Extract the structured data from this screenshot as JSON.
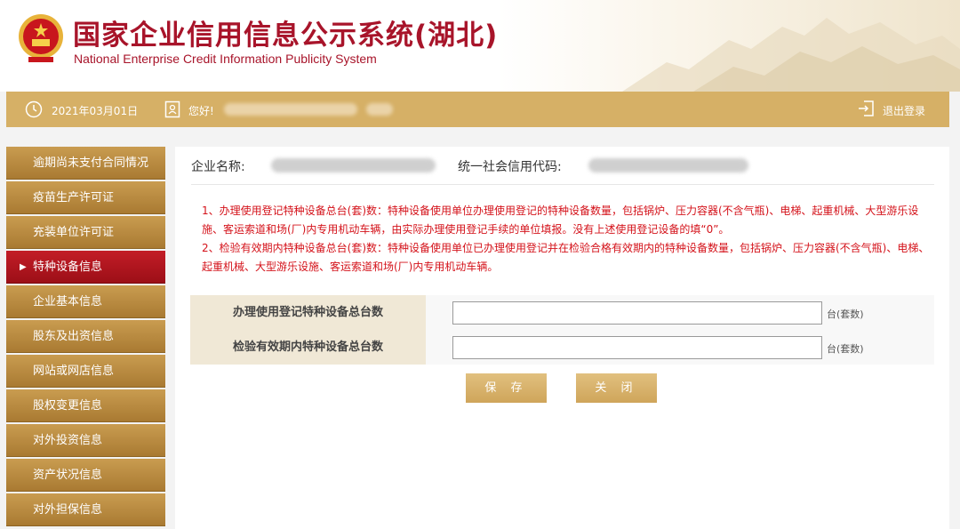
{
  "header": {
    "title": "国家企业信用信息公示系统(湖北)",
    "subtitle": "National Enterprise Credit Information Publicity System"
  },
  "topbar": {
    "date": "2021年03月01日",
    "greeting": "您好!",
    "logout_label": "退出登录"
  },
  "sidebar": {
    "items": [
      {
        "label": "逾期尚未支付合同情况",
        "active": false
      },
      {
        "label": "疫苗生产许可证",
        "active": false
      },
      {
        "label": "充装单位许可证",
        "active": false
      },
      {
        "label": "特种设备信息",
        "active": true
      },
      {
        "label": "企业基本信息",
        "active": false
      },
      {
        "label": "股东及出资信息",
        "active": false
      },
      {
        "label": "网站或网店信息",
        "active": false
      },
      {
        "label": "股权变更信息",
        "active": false
      },
      {
        "label": "对外投资信息",
        "active": false
      },
      {
        "label": "资产状况信息",
        "active": false
      },
      {
        "label": "对外担保信息",
        "active": false
      }
    ],
    "active_marker": "▶"
  },
  "company": {
    "name_label": "企业名称:",
    "code_label": "统一社会信用代码:"
  },
  "notes": {
    "note1": "1、办理使用登记特种设备总台(套)数：特种设备使用单位办理使用登记的特种设备数量，包括锅炉、压力容器(不含气瓶)、电梯、起重机械、大型游乐设施、客运索道和场(厂)内专用机动车辆，由实际办理使用登记手续的单位填报。没有上述使用登记设备的填“0”。",
    "note2": "2、检验有效期内特种设备总台(套)数：特种设备使用单位已办理使用登记并在检验合格有效期内的特种设备数量，包括锅炉、压力容器(不含气瓶)、电梯、起重机械、大型游乐设施、客运索道和场(厂)内专用机动车辆。"
  },
  "form": {
    "rows": [
      {
        "label": "办理使用登记特种设备总台数",
        "value": "",
        "unit": "台(套数)"
      },
      {
        "label": "检验有效期内特种设备总台数",
        "value": "",
        "unit": "台(套数)"
      }
    ]
  },
  "buttons": {
    "save": "保 存",
    "close": "关 闭"
  },
  "colors": {
    "brand_red": "#a8142a",
    "gold_bar": "#d6b066",
    "sidebar_gold": "#b8893f",
    "active_red": "#b5161f",
    "note_red": "#d4121a"
  }
}
